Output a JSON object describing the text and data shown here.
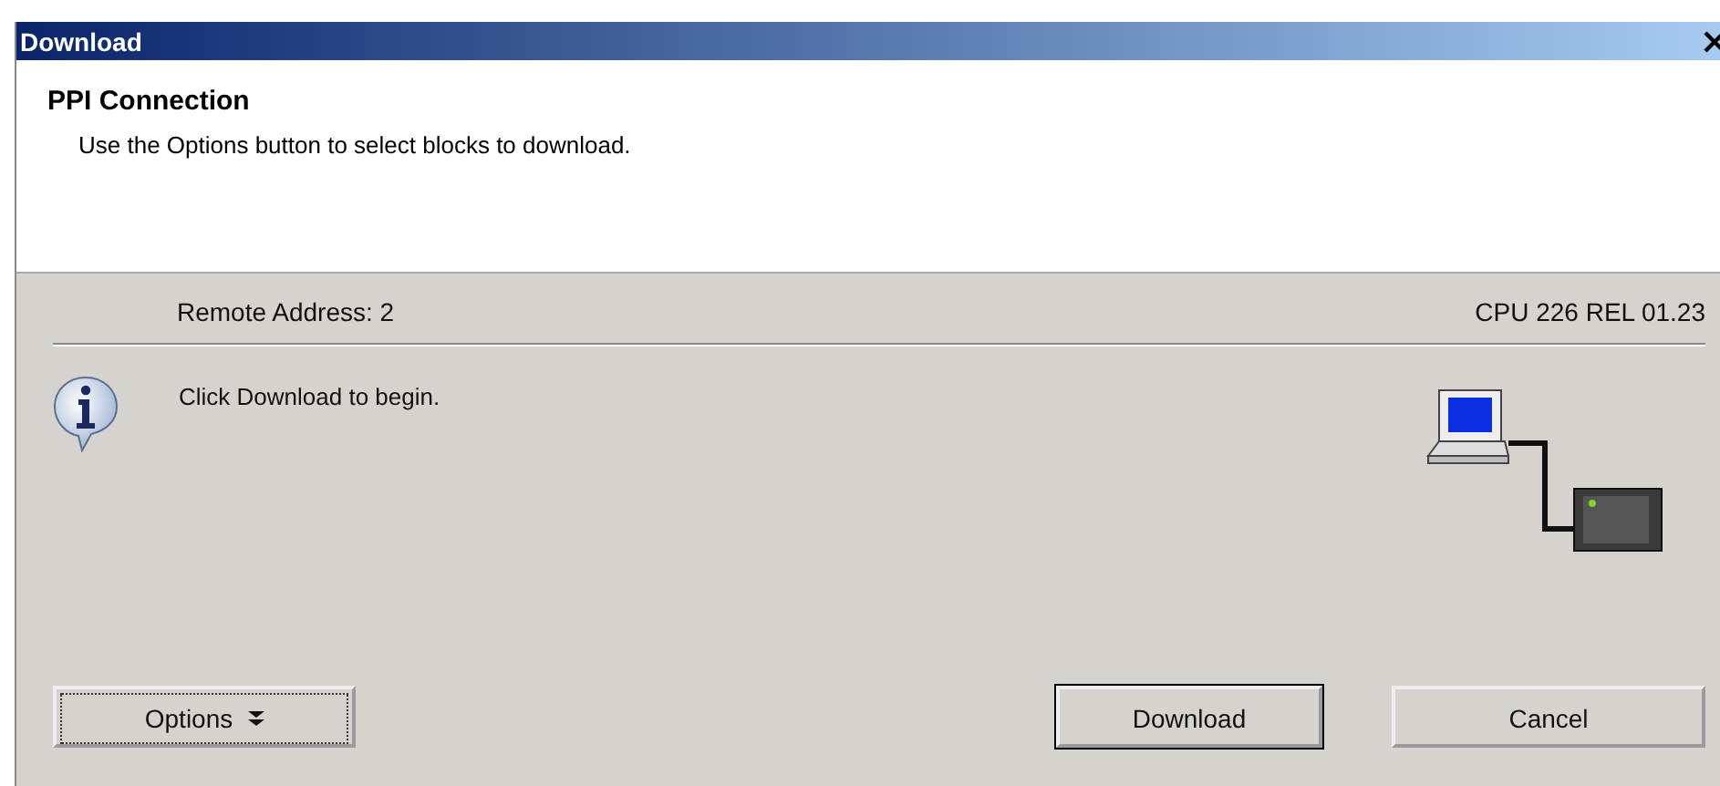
{
  "window": {
    "title": "Download"
  },
  "header": {
    "title": "PPI Connection",
    "subtitle": "Use the Options button to select blocks to download."
  },
  "remote_address": "Remote Address: 2",
  "cpu_info": "CPU 226 REL 01.23",
  "message": "Click Download to begin.",
  "buttons": [
    {
      "kind": "options",
      "label": "Options",
      "focused": true,
      "default": false
    },
    {
      "kind": "action",
      "label": "Download",
      "focused": false,
      "default": true
    },
    {
      "kind": "action",
      "label": "Cancel",
      "focused": false,
      "default": false
    }
  ]
}
